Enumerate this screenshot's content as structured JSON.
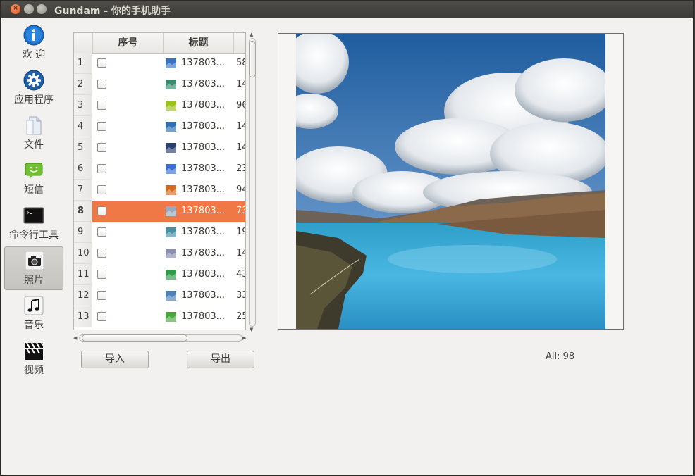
{
  "window": {
    "title": "Gundam - 你的手机助手",
    "close_glyph": "×"
  },
  "sidebar": {
    "items": [
      {
        "label": "欢 迎",
        "icon": "info-icon"
      },
      {
        "label": "应用程序",
        "icon": "gear-icon"
      },
      {
        "label": "文件",
        "icon": "file-icon"
      },
      {
        "label": "短信",
        "icon": "sms-icon"
      },
      {
        "label": "命令行工具",
        "icon": "terminal-icon"
      },
      {
        "label": "照片",
        "icon": "camera-icon",
        "selected": true
      },
      {
        "label": "音乐",
        "icon": "music-note-icon"
      },
      {
        "label": "视频",
        "icon": "clapperboard-icon"
      }
    ]
  },
  "table": {
    "columns": [
      "序号",
      "标题"
    ],
    "rows": [
      {
        "num": "1",
        "title": "137803...",
        "extra": "58",
        "thumb": "#3a73c4"
      },
      {
        "num": "2",
        "title": "137803...",
        "extra": "14",
        "thumb": "#3b8a6e"
      },
      {
        "num": "3",
        "title": "137803...",
        "extra": "96",
        "thumb": "#9bc21f"
      },
      {
        "num": "4",
        "title": "137803...",
        "extra": "14",
        "thumb": "#2f6fb2"
      },
      {
        "num": "5",
        "title": "137803...",
        "extra": "14",
        "thumb": "#2b3e6e"
      },
      {
        "num": "6",
        "title": "137803...",
        "extra": "23",
        "thumb": "#3d6fd1"
      },
      {
        "num": "7",
        "title": "137803...",
        "extra": "94",
        "thumb": "#d46a1a"
      },
      {
        "num": "8",
        "title": "137803...",
        "extra": "73",
        "thumb": "#9aa9b8",
        "selected": true
      },
      {
        "num": "9",
        "title": "137803...",
        "extra": "19",
        "thumb": "#4a8fa7"
      },
      {
        "num": "10",
        "title": "137803...",
        "extra": "14",
        "thumb": "#8a8fb0"
      },
      {
        "num": "11",
        "title": "137803...",
        "extra": "43",
        "thumb": "#2e9a4a"
      },
      {
        "num": "12",
        "title": "137803...",
        "extra": "33",
        "thumb": "#4d80b8"
      },
      {
        "num": "13",
        "title": "137803...",
        "extra": "25",
        "thumb": "#48a73c"
      }
    ]
  },
  "buttons": {
    "import_label": "导入",
    "export_label": "导出"
  },
  "status": {
    "count_text": "All: 98"
  },
  "colors": {
    "selection": "#f07746",
    "window_bg": "#f2f1f0",
    "titlebar": "#3c3b37"
  }
}
